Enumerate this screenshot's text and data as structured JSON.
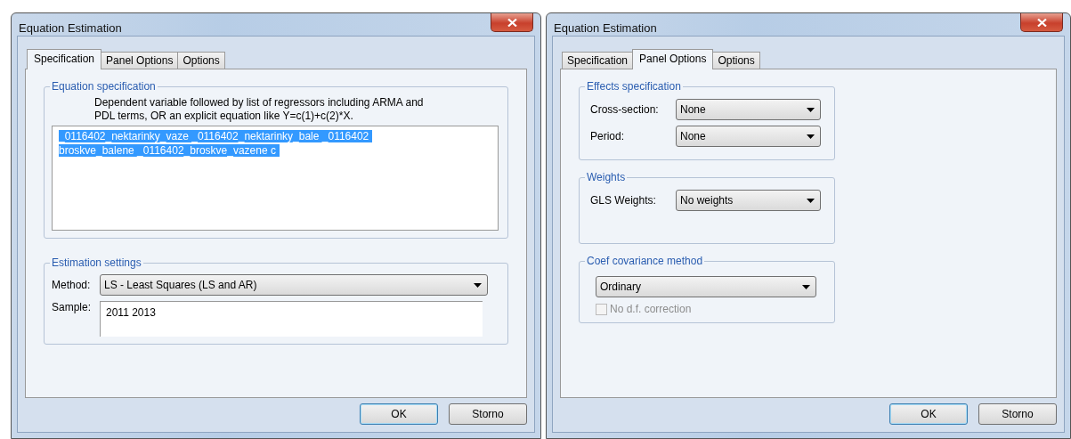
{
  "windows": [
    {
      "title": "Equation Estimation",
      "tabs": [
        {
          "label": "Specification",
          "selected": true
        },
        {
          "label": "Panel Options",
          "selected": false
        },
        {
          "label": "Options",
          "selected": false
        }
      ],
      "panel": {
        "kind": "specification",
        "equation": {
          "title": "Equation specification",
          "hint": "Dependent variable followed by list of regressors including ARMA and PDL terms, OR an explicit equation like Y=c(1)+c(2)*X.",
          "lines": [
            "_0116402_nektarinky_vaze _0116402_nektarinky_bale _0116402",
            "broskve_balene _0116402_broskve_vazene c"
          ],
          "selected": true
        },
        "settings": {
          "title": "Estimation settings",
          "method_label": "Method:",
          "method_value": "LS  -  Least Squares (LS and AR)",
          "sample_label": "Sample:",
          "sample_value": "2011 2013"
        }
      },
      "buttons": [
        {
          "label": "OK",
          "default": true
        },
        {
          "label": "Storno",
          "default": false
        }
      ]
    },
    {
      "title": "Equation Estimation",
      "tabs": [
        {
          "label": "Specification",
          "selected": false
        },
        {
          "label": "Panel Options",
          "selected": true
        },
        {
          "label": "Options",
          "selected": false
        }
      ],
      "panel": {
        "kind": "panel_options",
        "effects": {
          "title": "Effects specification",
          "fields": [
            {
              "label": "Cross-section:",
              "value": "None"
            },
            {
              "label": "Period:",
              "value": "None"
            }
          ]
        },
        "weights": {
          "title": "Weights",
          "fields": [
            {
              "label": "GLS Weights:",
              "value": "No weights"
            }
          ]
        },
        "covariance": {
          "title": "Coef covariance method",
          "value": "Ordinary",
          "checkbox": {
            "label": "No d.f. correction",
            "checked": false,
            "disabled": true
          }
        }
      },
      "buttons": [
        {
          "label": "OK",
          "default": true
        },
        {
          "label": "Storno",
          "default": false
        }
      ]
    }
  ]
}
